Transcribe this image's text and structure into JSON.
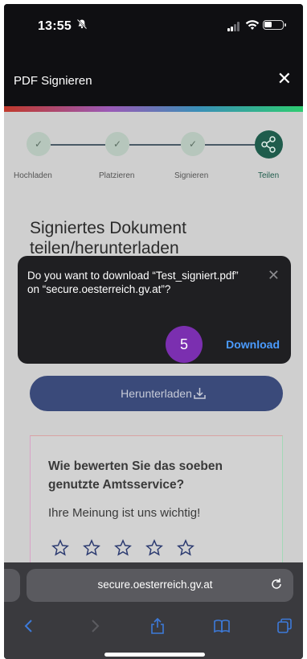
{
  "status_bar": {
    "time": "13:55",
    "icons": [
      "bell-slash-icon",
      "signal-icon",
      "wifi-icon",
      "battery-icon"
    ]
  },
  "app_bar": {
    "title": "PDF Signieren",
    "close_glyph": "✕"
  },
  "steps": {
    "items": [
      {
        "label": "Hochladen",
        "state": "done"
      },
      {
        "label": "Platzieren",
        "state": "done"
      },
      {
        "label": "Signieren",
        "state": "done"
      },
      {
        "label": "Teilen",
        "state": "active",
        "icon": "share-icon"
      }
    ]
  },
  "page": {
    "heading": "Signiertes Dokument teilen/herunterladen",
    "download_button_label": "Herunterladen",
    "feedback": {
      "question": "Wie bewerten Sie das soeben genutzte Amtsservice?",
      "subtitle": "Ihre Meinung ist uns wichtig!",
      "star_count": 5
    }
  },
  "popup": {
    "message": "Do you want to download “Test_signiert.pdf” on “secure.oesterreich.gv.at”?",
    "close_glyph": "✕",
    "download_label": "Download"
  },
  "step_badge": "5",
  "safari": {
    "url": "secure.oesterreich.gv.at",
    "toolbar_icons": [
      "back-icon",
      "forward-icon",
      "share-icon",
      "bookmarks-icon",
      "tabs-icon"
    ]
  },
  "colors": {
    "accent_link": "#4a9bff",
    "badge": "#7b2fb0",
    "primary_button": "#3a4a7a",
    "active_step": "#1f5c4c"
  }
}
